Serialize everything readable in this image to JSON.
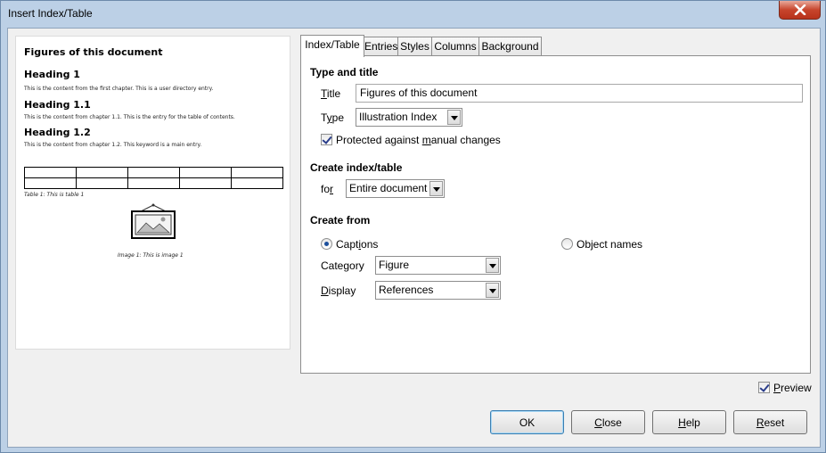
{
  "window": {
    "title": "Insert Index/Table"
  },
  "preview": {
    "title": "Figures of this document",
    "heading1": "Heading 1",
    "text1": "This is the content from the first chapter. This is a user directory entry.",
    "heading11": "Heading 1.1",
    "text11": "This is the content from chapter 1.1. This is the entry for the table of contents.",
    "heading12": "Heading 1.2",
    "text12": "This is the content from chapter 1.2. This keyword is a main entry.",
    "table_caption": "Table 1: This is table 1",
    "image_caption": "Image 1: This is image 1"
  },
  "tabs": [
    {
      "label": "Index/Table",
      "active": true
    },
    {
      "label": "Entries",
      "active": false
    },
    {
      "label": "Styles",
      "active": false
    },
    {
      "label": "Columns",
      "active": false
    },
    {
      "label": "Background",
      "active": false
    }
  ],
  "type_and_title": {
    "heading": "Type and title",
    "title_label_u": "T",
    "title_label_rest": "itle",
    "title_value": "Figures of this document",
    "type_label_pre": "T",
    "type_label_u": "y",
    "type_label_rest": "pe",
    "type_value": "Illustration Index",
    "protected_pre": "Protected against ",
    "protected_u": "m",
    "protected_rest": "anual changes",
    "protected_checked": true
  },
  "create_index": {
    "heading": "Create index/table",
    "for_pre": "fo",
    "for_u": "r",
    "for_value": "Entire document"
  },
  "create_from": {
    "heading": "Create from",
    "captions_pre": "Capt",
    "captions_u": "i",
    "captions_rest": "ons",
    "captions_selected": true,
    "object_names_label": "Object names",
    "category_label": "Category",
    "category_value": "Figure",
    "display_u": "D",
    "display_rest": "isplay",
    "display_value": "References"
  },
  "preview_toggle": {
    "label_u": "P",
    "label_rest": "review",
    "checked": true
  },
  "buttons": {
    "ok": "OK",
    "close_u": "C",
    "close_rest": "lose",
    "help_u": "H",
    "help_rest": "elp",
    "reset_u": "R",
    "reset_rest": "eset"
  }
}
